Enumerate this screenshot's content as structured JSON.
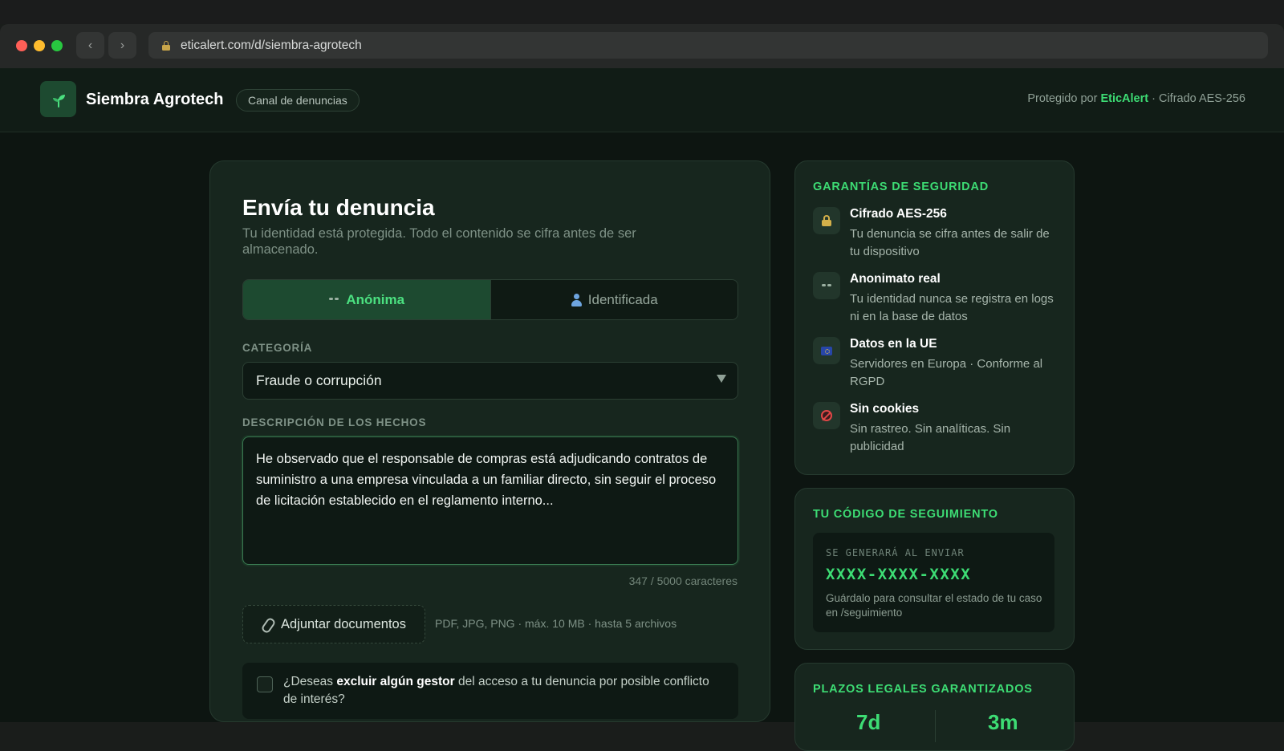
{
  "browser": {
    "url": "eticalert.com/d/siembra-agrotech",
    "back_label": "‹",
    "forward_label": "›"
  },
  "header": {
    "brand": "Siembra Agrotech",
    "chip": "Canal de denuncias",
    "protected_prefix": "Protegido por",
    "protected_brand": "EticAlert",
    "protected_suffix": "· Cifrado AES-256"
  },
  "form": {
    "title": "Envía tu denuncia",
    "subtitle": "Tu identidad está protegida. Todo el contenido se cifra antes de ser almacenado.",
    "modes": [
      {
        "label": "Anónima",
        "icon": "mask-icon",
        "active": true
      },
      {
        "label": "Identificada",
        "icon": "person-icon",
        "active": false
      }
    ],
    "category_label": "CATEGORÍA",
    "category_value": "Fraude o corrupción",
    "description_label": "DESCRIPCIÓN DE LOS HECHOS",
    "description_value": "He observado que el responsable de compras está adjudicando contratos de suministro a una empresa vinculada a un familiar directo, sin seguir el proceso de licitación establecido en el reglamento interno...",
    "counter": "347 / 5000 caracteres",
    "attach_label": "Adjuntar documentos",
    "attach_hint": "PDF, JPG, PNG · máx. 10 MB · hasta 5 archivos",
    "exclude_pre": "¿Deseas",
    "exclude_bold": "excluir algún gestor",
    "exclude_post": "del acceso a tu denuncia por posible conflicto de interés?",
    "exclude_checked": false
  },
  "guarantees": {
    "title": "GARANTÍAS DE SEGURIDAD",
    "items": [
      {
        "icon": "lock-icon",
        "title": "Cifrado AES-256",
        "desc": "Tu denuncia se cifra antes de salir de tu dispositivo"
      },
      {
        "icon": "mask-icon",
        "title": "Anonimato real",
        "desc": "Tu identidad nunca se registra en logs ni en la base de datos"
      },
      {
        "icon": "eu-flag-icon",
        "title": "Datos en la UE",
        "desc": "Servidores en Europa · Conforme al RGPD"
      },
      {
        "icon": "no-cookies-icon",
        "title": "Sin cookies",
        "desc": "Sin rastreo. Sin analíticas. Sin publicidad"
      }
    ]
  },
  "tracking": {
    "title": "TU CÓDIGO DE SEGUIMIENTO",
    "label": "SE GENERARÁ AL ENVIAR",
    "code": "XXXX-XXXX-XXXX",
    "note": "Guárdalo para consultar el estado de tu caso en /seguimiento"
  },
  "deadlines": {
    "title": "PLAZOS LEGALES GARANTIZADOS",
    "values": [
      "7d",
      "3m"
    ]
  },
  "colors": {
    "accent": "#3ddc74",
    "background": "#0d1511",
    "card": "#17261e"
  }
}
